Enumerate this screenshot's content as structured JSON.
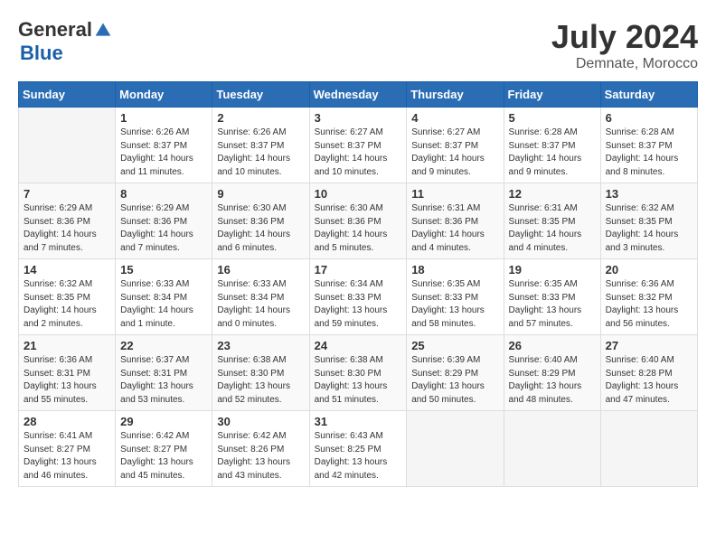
{
  "logo": {
    "general": "General",
    "blue": "Blue"
  },
  "title": "July 2024",
  "location": "Demnate, Morocco",
  "days_of_week": [
    "Sunday",
    "Monday",
    "Tuesday",
    "Wednesday",
    "Thursday",
    "Friday",
    "Saturday"
  ],
  "weeks": [
    [
      {
        "day": "",
        "info": ""
      },
      {
        "day": "1",
        "info": "Sunrise: 6:26 AM\nSunset: 8:37 PM\nDaylight: 14 hours\nand 11 minutes."
      },
      {
        "day": "2",
        "info": "Sunrise: 6:26 AM\nSunset: 8:37 PM\nDaylight: 14 hours\nand 10 minutes."
      },
      {
        "day": "3",
        "info": "Sunrise: 6:27 AM\nSunset: 8:37 PM\nDaylight: 14 hours\nand 10 minutes."
      },
      {
        "day": "4",
        "info": "Sunrise: 6:27 AM\nSunset: 8:37 PM\nDaylight: 14 hours\nand 9 minutes."
      },
      {
        "day": "5",
        "info": "Sunrise: 6:28 AM\nSunset: 8:37 PM\nDaylight: 14 hours\nand 9 minutes."
      },
      {
        "day": "6",
        "info": "Sunrise: 6:28 AM\nSunset: 8:37 PM\nDaylight: 14 hours\nand 8 minutes."
      }
    ],
    [
      {
        "day": "7",
        "info": "Sunrise: 6:29 AM\nSunset: 8:36 PM\nDaylight: 14 hours\nand 7 minutes."
      },
      {
        "day": "8",
        "info": "Sunrise: 6:29 AM\nSunset: 8:36 PM\nDaylight: 14 hours\nand 7 minutes."
      },
      {
        "day": "9",
        "info": "Sunrise: 6:30 AM\nSunset: 8:36 PM\nDaylight: 14 hours\nand 6 minutes."
      },
      {
        "day": "10",
        "info": "Sunrise: 6:30 AM\nSunset: 8:36 PM\nDaylight: 14 hours\nand 5 minutes."
      },
      {
        "day": "11",
        "info": "Sunrise: 6:31 AM\nSunset: 8:36 PM\nDaylight: 14 hours\nand 4 minutes."
      },
      {
        "day": "12",
        "info": "Sunrise: 6:31 AM\nSunset: 8:35 PM\nDaylight: 14 hours\nand 4 minutes."
      },
      {
        "day": "13",
        "info": "Sunrise: 6:32 AM\nSunset: 8:35 PM\nDaylight: 14 hours\nand 3 minutes."
      }
    ],
    [
      {
        "day": "14",
        "info": "Sunrise: 6:32 AM\nSunset: 8:35 PM\nDaylight: 14 hours\nand 2 minutes."
      },
      {
        "day": "15",
        "info": "Sunrise: 6:33 AM\nSunset: 8:34 PM\nDaylight: 14 hours\nand 1 minute."
      },
      {
        "day": "16",
        "info": "Sunrise: 6:33 AM\nSunset: 8:34 PM\nDaylight: 14 hours\nand 0 minutes."
      },
      {
        "day": "17",
        "info": "Sunrise: 6:34 AM\nSunset: 8:33 PM\nDaylight: 13 hours\nand 59 minutes."
      },
      {
        "day": "18",
        "info": "Sunrise: 6:35 AM\nSunset: 8:33 PM\nDaylight: 13 hours\nand 58 minutes."
      },
      {
        "day": "19",
        "info": "Sunrise: 6:35 AM\nSunset: 8:33 PM\nDaylight: 13 hours\nand 57 minutes."
      },
      {
        "day": "20",
        "info": "Sunrise: 6:36 AM\nSunset: 8:32 PM\nDaylight: 13 hours\nand 56 minutes."
      }
    ],
    [
      {
        "day": "21",
        "info": "Sunrise: 6:36 AM\nSunset: 8:31 PM\nDaylight: 13 hours\nand 55 minutes."
      },
      {
        "day": "22",
        "info": "Sunrise: 6:37 AM\nSunset: 8:31 PM\nDaylight: 13 hours\nand 53 minutes."
      },
      {
        "day": "23",
        "info": "Sunrise: 6:38 AM\nSunset: 8:30 PM\nDaylight: 13 hours\nand 52 minutes."
      },
      {
        "day": "24",
        "info": "Sunrise: 6:38 AM\nSunset: 8:30 PM\nDaylight: 13 hours\nand 51 minutes."
      },
      {
        "day": "25",
        "info": "Sunrise: 6:39 AM\nSunset: 8:29 PM\nDaylight: 13 hours\nand 50 minutes."
      },
      {
        "day": "26",
        "info": "Sunrise: 6:40 AM\nSunset: 8:29 PM\nDaylight: 13 hours\nand 48 minutes."
      },
      {
        "day": "27",
        "info": "Sunrise: 6:40 AM\nSunset: 8:28 PM\nDaylight: 13 hours\nand 47 minutes."
      }
    ],
    [
      {
        "day": "28",
        "info": "Sunrise: 6:41 AM\nSunset: 8:27 PM\nDaylight: 13 hours\nand 46 minutes."
      },
      {
        "day": "29",
        "info": "Sunrise: 6:42 AM\nSunset: 8:27 PM\nDaylight: 13 hours\nand 45 minutes."
      },
      {
        "day": "30",
        "info": "Sunrise: 6:42 AM\nSunset: 8:26 PM\nDaylight: 13 hours\nand 43 minutes."
      },
      {
        "day": "31",
        "info": "Sunrise: 6:43 AM\nSunset: 8:25 PM\nDaylight: 13 hours\nand 42 minutes."
      },
      {
        "day": "",
        "info": ""
      },
      {
        "day": "",
        "info": ""
      },
      {
        "day": "",
        "info": ""
      }
    ]
  ]
}
